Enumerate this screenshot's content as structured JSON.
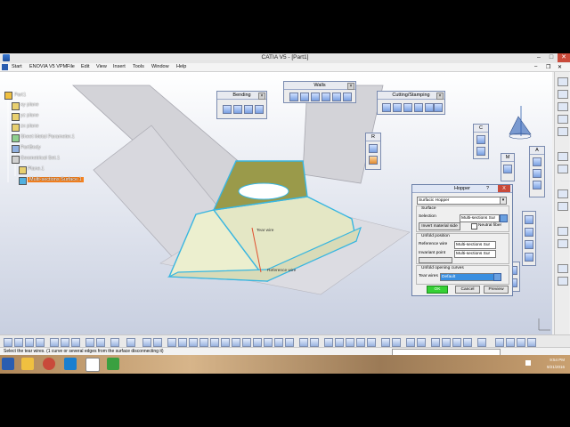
{
  "window": {
    "title": "CATIA V5 - [Part1]",
    "min_label": "–",
    "max_label": "□",
    "close_label": "✕"
  },
  "menubar": {
    "items": [
      "Start",
      "ENOVIA V5 VPM",
      "File",
      "Edit",
      "View",
      "Insert",
      "Tools",
      "Window",
      "Help"
    ]
  },
  "tree": {
    "root": "Part1",
    "items": [
      "xy plane",
      "yz plane",
      "zx plane",
      "Sheet Metal Parameter.1",
      "PartBody",
      "Geometrical Set.1",
      "Plane.1",
      "Multi-sections Surface.1"
    ]
  },
  "toolbars": {
    "bending": "Bending",
    "walls": "Walls",
    "cutting": "Cutting/Stamping",
    "small_r": "R",
    "small_c": "C",
    "small_m": "M",
    "small_a": "A"
  },
  "viewport": {
    "labels": [
      "Tear wire",
      "Reference wire"
    ]
  },
  "hopper_dialog": {
    "title": "Hopper",
    "help_label": "?",
    "close_label": "X",
    "type_value": "Surfacic Hopper",
    "surface_group": "Surface",
    "selection_label": "Selection",
    "selection_value": "Multi-sections Sur",
    "invert_label": "Invert material side",
    "neutral_label": "Neutral fiber",
    "unfold_group": "Unfold position",
    "reference_wire_label": "Reference wire",
    "reference_wire_value": "Multi-sections Sur",
    "invariant_point_label": "Invariant point",
    "invariant_point_value": "Multi-sections Sur",
    "opening_group": "Unfold opening curves",
    "tear_wires_label": "Tear wires",
    "tear_wires_value": "Default",
    "ok_label": "OK",
    "cancel_label": "Cancel",
    "preview_label": "Preview"
  },
  "status": {
    "text": "Select the tear wires. (1 curve or several edges from the surface disconnecting it)"
  },
  "clock": {
    "time": "9:54 PM",
    "date": "9/21/2016"
  },
  "colors": {
    "viewport_top": "#ffffff",
    "viewport_bottom": "#c8cfe0",
    "selected_tree": "#f58220",
    "part_face": "#eef0d0",
    "part_edge": "#39b6e0",
    "ok_highlight": "#35d135"
  }
}
